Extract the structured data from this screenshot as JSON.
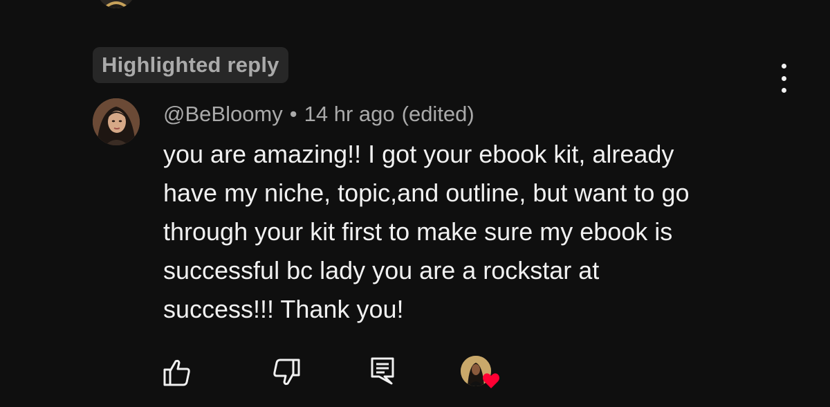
{
  "highlight_label": "Highlighted reply",
  "comment": {
    "author": "@BeBloomy",
    "separator": "•",
    "timestamp": "14 hr ago",
    "edited": "(edited)",
    "text_lines": [
      "you are amazing!! I got your ebook kit, already",
      "have my niche, topic,and outline, but want to go",
      "through your kit first to make sure my ebook is",
      "successful bc lady you are a rockstar at",
      "success!!! Thank you!"
    ]
  },
  "actions": {
    "like_icon": "thumbs-up-icon",
    "dislike_icon": "thumbs-down-icon",
    "reply_icon": "reply-comment-icon",
    "creator_heart_icon": "heart-icon"
  },
  "colors": {
    "background": "#0f0f0f",
    "chip_background": "#272727",
    "secondary_text": "#aaaaaa",
    "primary_text": "#f1f1f1",
    "heart": "#ff0033"
  }
}
